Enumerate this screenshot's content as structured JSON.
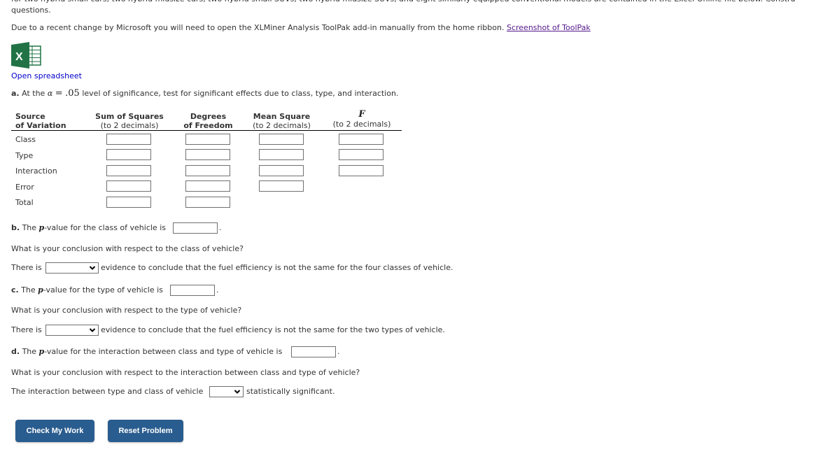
{
  "intro": {
    "cut_line": "for two hybrid small cars, two hybrid midsize cars, two hybrid small SUVs, two hybrid midsize SUVs, and eight similarly equipped conventional models are contained in the Excel Online file below. Constru",
    "questions_word": "questions.",
    "toolpak_note": "Due to a recent change by Microsoft you will need to open the XLMiner Analysis ToolPak add-in manually from the home ribbon.",
    "toolpak_link": "Screenshot of ToolPak"
  },
  "spreadsheet": {
    "icon": "excel-icon",
    "link_label": "Open spreadsheet",
    "brand_color": "#217346"
  },
  "part_a": {
    "letter": "a.",
    "text_before": "At the",
    "alpha_symbol": "α",
    "equals": "=",
    "alpha_value": ".05",
    "text_after": "level of significance, test for significant effects due to class, type, and interaction."
  },
  "anova": {
    "headers": [
      {
        "line1": "Source",
        "line2": "of Variation"
      },
      {
        "line1": "Sum of Squares",
        "line2": "(to 2 decimals)"
      },
      {
        "line1": "Degrees",
        "line2": "of Freedom"
      },
      {
        "line1": "Mean Square",
        "line2": "(to 2 decimals)"
      },
      {
        "line1": "F",
        "line2": "(to 2 decimals)"
      }
    ],
    "rows": [
      {
        "label": "Class",
        "ss": "",
        "df": "",
        "ms": "",
        "f": ""
      },
      {
        "label": "Type",
        "ss": "",
        "df": "",
        "ms": "",
        "f": ""
      },
      {
        "label": "Interaction",
        "ss": "",
        "df": "",
        "ms": "",
        "f": ""
      },
      {
        "label": "Error",
        "ss": "",
        "df": "",
        "ms": ""
      },
      {
        "label": "Total",
        "ss": "",
        "df": ""
      }
    ]
  },
  "part_b": {
    "letter": "b.",
    "pvalue_prefix": "The",
    "p_symbol": "p",
    "pvalue_text": "-value for the class of vehicle is",
    "pvalue_input": "",
    "period": ".",
    "question": "What is your conclusion with respect to the class of vehicle?",
    "conclusion_prefix": "There is",
    "conclusion_select": "",
    "conclusion_suffix": "evidence to conclude that the fuel efficiency is not the same for the four classes of vehicle."
  },
  "part_c": {
    "letter": "c.",
    "pvalue_prefix": "The",
    "p_symbol": "p",
    "pvalue_text": "-value for the type of vehicle is",
    "pvalue_input": "",
    "period": ".",
    "question": "What is your conclusion with respect to the type of vehicle?",
    "conclusion_prefix": "There is",
    "conclusion_select": "",
    "conclusion_suffix": "evidence to conclude that the fuel efficiency is not the same for the two types of vehicle."
  },
  "part_d": {
    "letter": "d.",
    "pvalue_prefix": "The",
    "p_symbol": "p",
    "pvalue_text": "-value for the interaction between class and type of vehicle is",
    "pvalue_input": "",
    "period": ".",
    "question": "What is your conclusion with respect to the interaction between class and type of vehicle?",
    "conclusion_prefix": "The interaction between type and class of vehicle",
    "conclusion_select": "",
    "conclusion_suffix": "statistically significant."
  },
  "buttons": {
    "check": "Check My Work",
    "reset": "Reset Problem",
    "color": "#2a5d8f"
  }
}
